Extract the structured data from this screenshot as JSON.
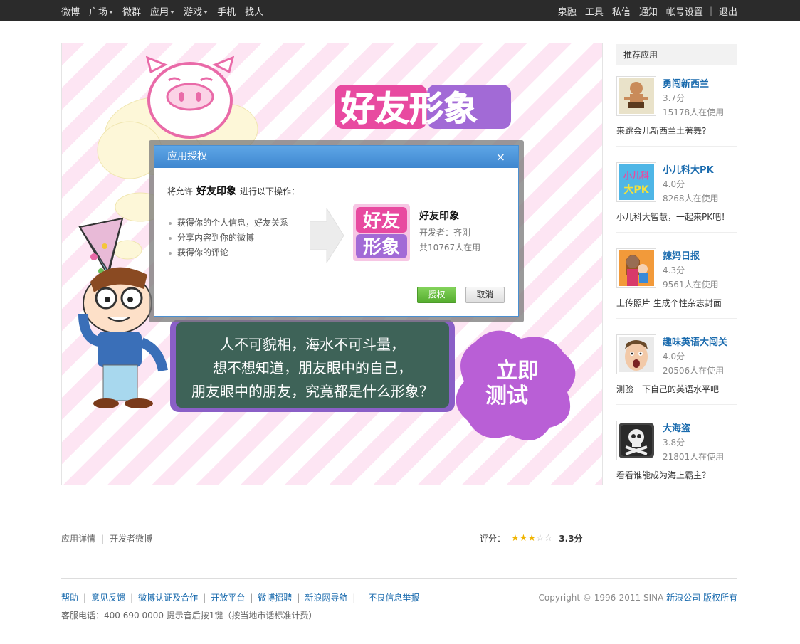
{
  "topnav": {
    "left": [
      {
        "label": "微博",
        "dropdown": false
      },
      {
        "label": "广场",
        "dropdown": true
      },
      {
        "label": "微群",
        "dropdown": false
      },
      {
        "label": "应用",
        "dropdown": true
      },
      {
        "label": "游戏",
        "dropdown": true
      },
      {
        "label": "手机",
        "dropdown": false
      },
      {
        "label": "找人",
        "dropdown": false
      }
    ],
    "right": [
      "泉融",
      "工具",
      "私信",
      "通知",
      "帐号设置"
    ],
    "logout": "退出"
  },
  "banner": {
    "logo_text": "好友形象",
    "board_lines": [
      "人不可貌相，海水不可斗量，",
      "想不想知道，朋友眼中的自己，",
      "朋友眼中的朋友，究竟都是什么形象？"
    ],
    "splash_lines": [
      "立即",
      "测试"
    ]
  },
  "dialog": {
    "title": "应用授权",
    "close_glyph": "×",
    "allow_prefix": "将允许",
    "app_name": "好友印象",
    "allow_suffix": "进行以下操作：",
    "permissions": [
      "获得你的个人信息，好友关系",
      "分享内容到你的微博",
      "获得你的评论"
    ],
    "icon_text": [
      "好友",
      "形象"
    ],
    "developer": "开发者：齐刚",
    "users": "共10767人在用",
    "ok_label": "授权",
    "cancel_label": "取消"
  },
  "sidebar": {
    "title": "推荐应用",
    "apps": [
      {
        "name": "勇闯新西兰",
        "score": "3.7分",
        "count": "15178人在使用",
        "desc": "来跳会儿新西兰土著舞?",
        "icon": "tribal-dancer-icon"
      },
      {
        "name": "小儿科大PK",
        "score": "4.0分",
        "count": "8268人在使用",
        "desc": "小儿科大智慧，一起来PK吧！",
        "icon": "quiz-pk-icon",
        "icon_text": [
          "小儿科",
          "大PK"
        ]
      },
      {
        "name": "辣妈日报",
        "score": "4.3分",
        "count": "9561人在使用",
        "desc": "上传照片 生成个性杂志封面",
        "icon": "mom-baby-icon"
      },
      {
        "name": "趣味英语大闯关",
        "score": "4.0分",
        "count": "20506人在使用",
        "desc": "测验一下自己的英语水平吧",
        "icon": "surprised-face-icon"
      },
      {
        "name": "大海盗",
        "score": "3.8分",
        "count": "21801人在使用",
        "desc": "看看谁能成为海上霸主？",
        "icon": "skull-crossbones-icon"
      }
    ]
  },
  "under": {
    "link1": "应用详情",
    "sep": "|",
    "link2": "开发者微博",
    "rating_label": "评分：",
    "rating_value": 3.3,
    "rating_max": 5,
    "rating_text": "3.3分"
  },
  "footer": {
    "links": [
      "帮助",
      "意见反馈",
      "微博认证及合作",
      "开放平台",
      "微博招聘",
      "新浪网导航",
      "不良信息举报"
    ],
    "tel": "客服电话：400 690 0000 提示音后按1键（按当地市话标准计费）",
    "copyright_prefix": "Copyright © 1996-2011 SINA",
    "company": "新浪公司",
    "rights": "版权所有"
  },
  "colors": {
    "topbar": "#2b2b2b",
    "link": "#1a6bae",
    "dialog_title": "#4a97dc",
    "ok_button": "#63bb3a",
    "stripe_pink": "#fde5f3"
  }
}
